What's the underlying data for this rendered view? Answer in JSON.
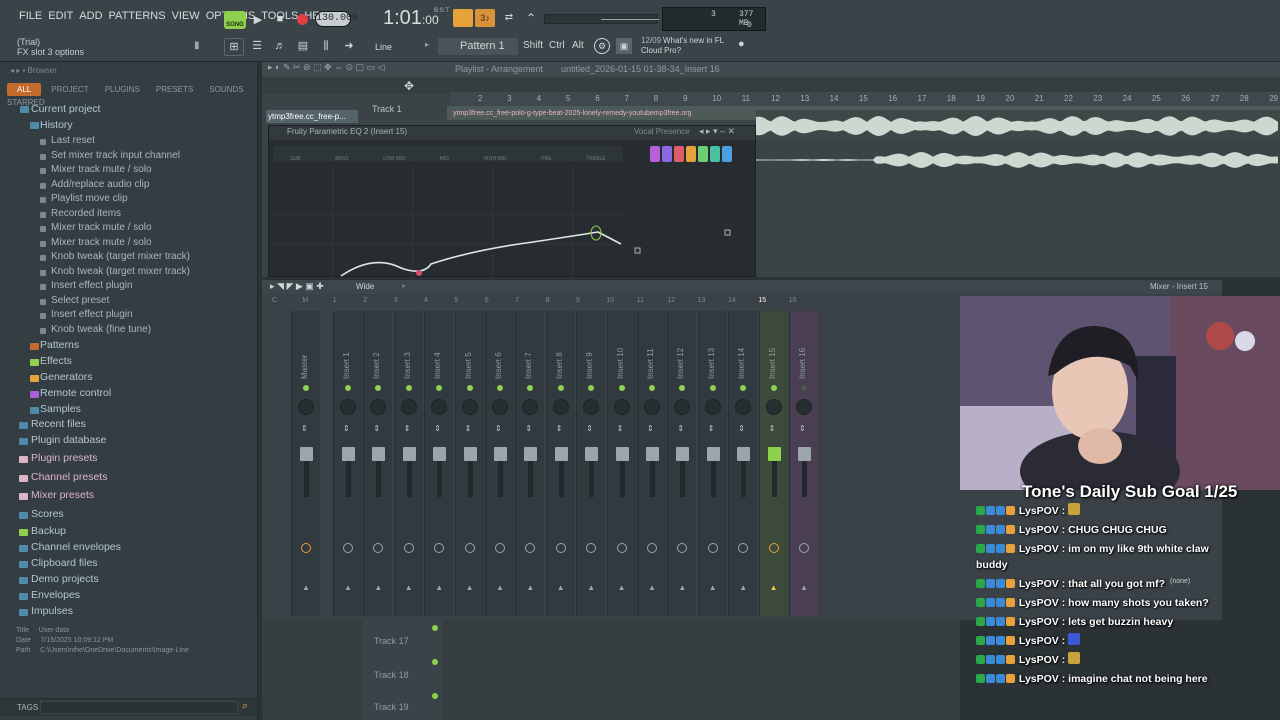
{
  "menu": [
    "FILE",
    "EDIT",
    "ADD",
    "PATTERNS",
    "VIEW",
    "OPTIONS",
    "TOOLS",
    "HELP"
  ],
  "transport": {
    "song_badge": "SONG",
    "tempo": "130.000",
    "time": "1:01",
    "time_sub": ":00",
    "time_small": "B:S:T",
    "cpu": "3",
    "mem": "377 MB",
    "poly": "0"
  },
  "hint": {
    "trial": "(Trial)",
    "text": "FX slot 3 options"
  },
  "pattern": {
    "snap": "Line",
    "name": "Pattern 1",
    "shift": "Shift",
    "ctrl": "Ctrl",
    "alt": "Alt"
  },
  "news": {
    "date": "12/09",
    "text": "What's new in FL Cloud Pro?"
  },
  "browser": {
    "title": "Browser",
    "tabs": [
      "ALL",
      "PROJECT",
      "PLUGINS",
      "PRESETS",
      "SOUNDS",
      "STARRED"
    ],
    "current": "Current project",
    "history": "History",
    "history_items": [
      "Last reset",
      "Set mixer track input channel",
      "Mixer track mute / solo",
      "Add/replace audio clip",
      "Playlist move clip",
      "Recorded items",
      "Mixer track mute / solo",
      "Mixer track mute / solo",
      "Knob tweak (target mixer track)",
      "Knob tweak (target mixer track)",
      "Insert effect plugin",
      "Select preset",
      "Insert effect plugin",
      "Knob tweak (fine tune)"
    ],
    "project_items": [
      "Patterns",
      "Effects",
      "Generators",
      "Remote control",
      "Samples"
    ],
    "root_items": [
      "Recent files",
      "Plugin database",
      "Plugin presets",
      "Channel presets",
      "Mixer presets",
      "Scores",
      "Backup",
      "Channel envelopes",
      "Clipboard files",
      "Demo projects",
      "Envelopes",
      "Impulses"
    ],
    "info": {
      "title_label": "Title",
      "title_value": "User data",
      "date_label": "Date",
      "date_value": "7/15/2025 10:09:12 PM",
      "path_label": "Path",
      "path_value": "C:\\Users\\nthe\\OneDrive\\Documents\\Image-Line"
    },
    "tags": "TAGS"
  },
  "playlist": {
    "title": "Playlist - Arrangement",
    "file": "untitled_2026-01-15 01-38-34_Insert 16",
    "track1": "Track 1",
    "clip": "ytmp3free.cc_free-polo-g-type-beat-2025-lonely-remedy-youtubemp3free.org",
    "clip_short": "ytmp3free.cc_free-p...",
    "ruler": [
      "2",
      "3",
      "4",
      "5",
      "6",
      "7",
      "8",
      "9",
      "10",
      "11",
      "12",
      "13",
      "14",
      "15",
      "16",
      "17",
      "18",
      "19",
      "20",
      "21",
      "22",
      "23",
      "24",
      "25",
      "26",
      "27",
      "28",
      "29"
    ]
  },
  "eq": {
    "title": "Fruity Parametric EQ 2",
    "insert": "(Insert 15)",
    "preset": "Vocal Presence",
    "bands": [
      "SUB",
      "BASS",
      "LOW MID",
      "MID",
      "HIGH MID",
      "PRE",
      "TREBLE"
    ]
  },
  "mixer": {
    "title": "Mixer - Insert 15",
    "mode": "Wide",
    "strips": [
      "Master",
      "Insert 1",
      "Insert 2",
      "Insert 3",
      "Insert 4",
      "Insert 5",
      "Insert 6",
      "Insert 7",
      "Insert 8",
      "Insert 9",
      "Insert 10",
      "Insert 11",
      "Insert 12",
      "Insert 13",
      "Insert 14",
      "Insert 15",
      "Insert 16"
    ],
    "numbers": [
      "C",
      "M",
      "1",
      "2",
      "3",
      "4",
      "5",
      "6",
      "7",
      "8",
      "9",
      "10",
      "11",
      "12",
      "13",
      "14",
      "15",
      "16"
    ]
  },
  "tracks": [
    "Track 17",
    "Track 18",
    "Track 19"
  ],
  "stream": {
    "goal": "Tone's Daily Sub Goal 1/25",
    "none_label": "(none)",
    "chat": [
      {
        "user": "LysPOV",
        "msg": ""
      },
      {
        "user": "LysPOV",
        "msg": "CHUG CHUG CHUG"
      },
      {
        "user": "LysPOV",
        "msg": "im on my like 9th white claw buddy"
      },
      {
        "user": "LysPOV",
        "msg": "that all you got mf?"
      },
      {
        "user": "LysPOV",
        "msg": "how many shots you taken?"
      },
      {
        "user": "LysPOV",
        "msg": "lets get buzzin heavy"
      },
      {
        "user": "LysPOV",
        "msg": ""
      },
      {
        "user": "LysPOV",
        "msg": ""
      },
      {
        "user": "LysPOV",
        "msg": "imagine chat not being here"
      }
    ]
  },
  "colors": {
    "accent_green": "#8fd14f",
    "record_red": "#e24040",
    "orange": "#e8a23a",
    "pink": "#dcb4c8"
  }
}
